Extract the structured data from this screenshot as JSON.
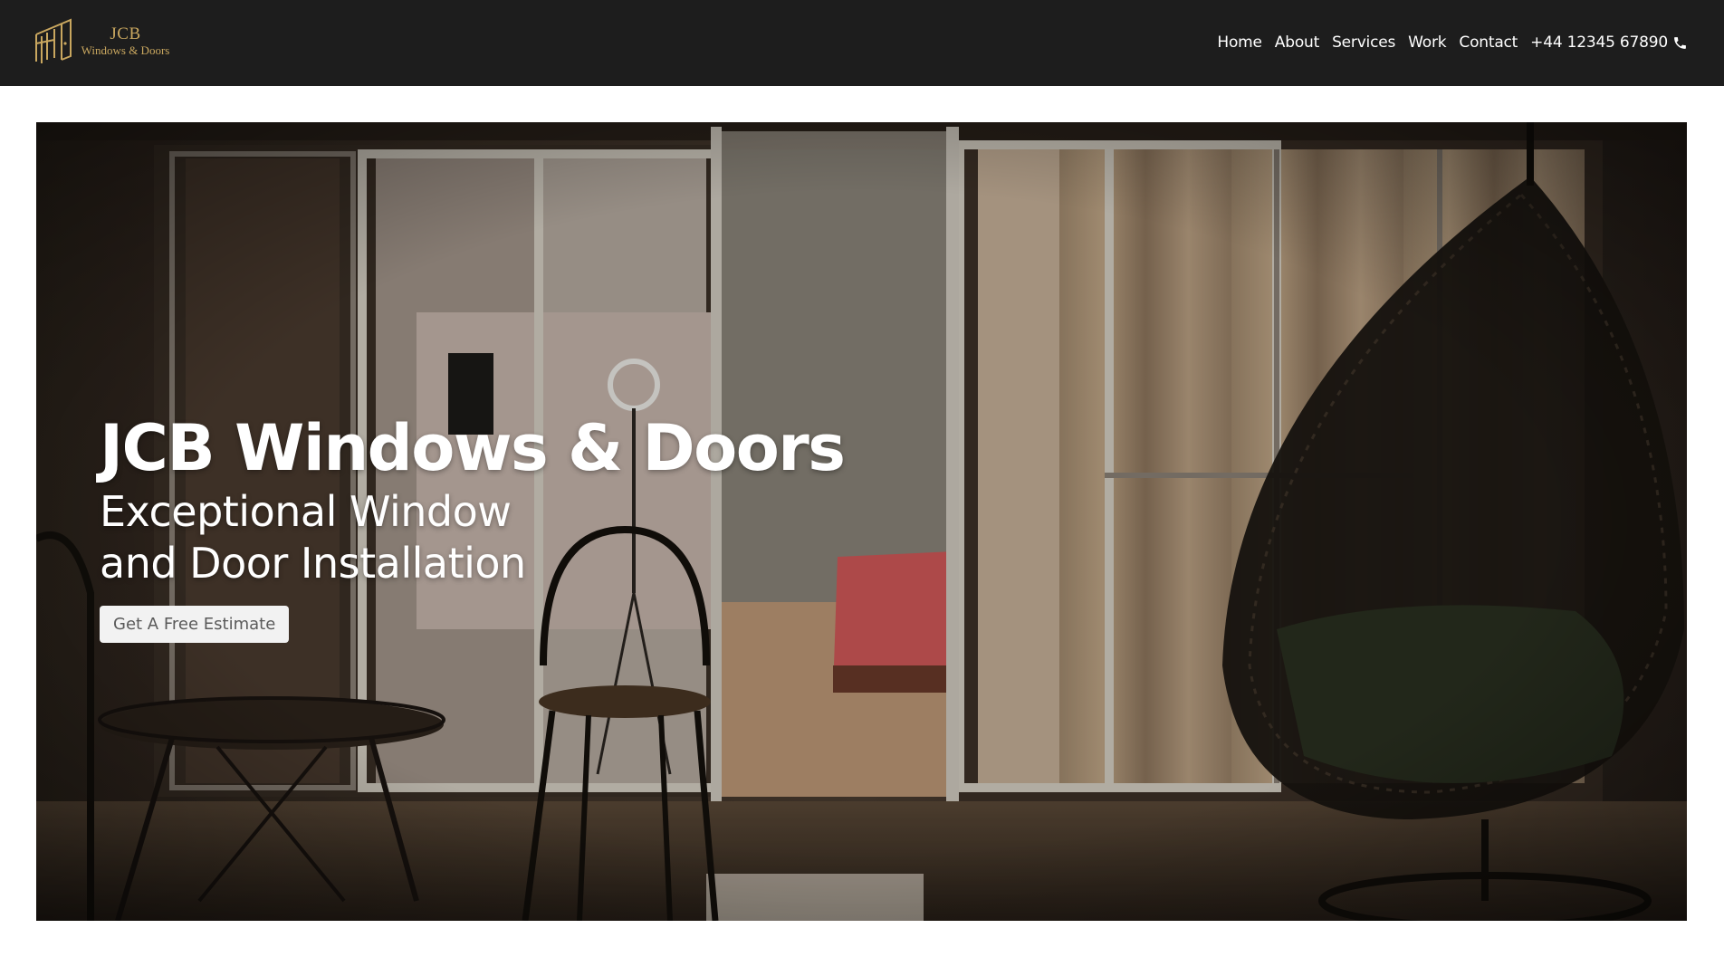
{
  "brand": {
    "name": "JCB",
    "tagline": "Windows & Doors",
    "accent_color": "#c9a75f",
    "logo_icon": "window-frame-logo-icon"
  },
  "nav": {
    "items": [
      {
        "label": "Home"
      },
      {
        "label": "About"
      },
      {
        "label": "Services"
      },
      {
        "label": "Work"
      },
      {
        "label": "Contact"
      }
    ],
    "phone": "+44 12345 67890",
    "phone_icon": "phone-icon"
  },
  "hero": {
    "title": "JCB Windows & Doors",
    "subtitle_line1": "Exceptional Window",
    "subtitle_line2": "and Door Installation",
    "cta_label": "Get A Free Estimate"
  },
  "colors": {
    "header_bg": "#1d1d1d",
    "page_bg": "#ffffff",
    "cta_bg": "#f2f2f2"
  }
}
